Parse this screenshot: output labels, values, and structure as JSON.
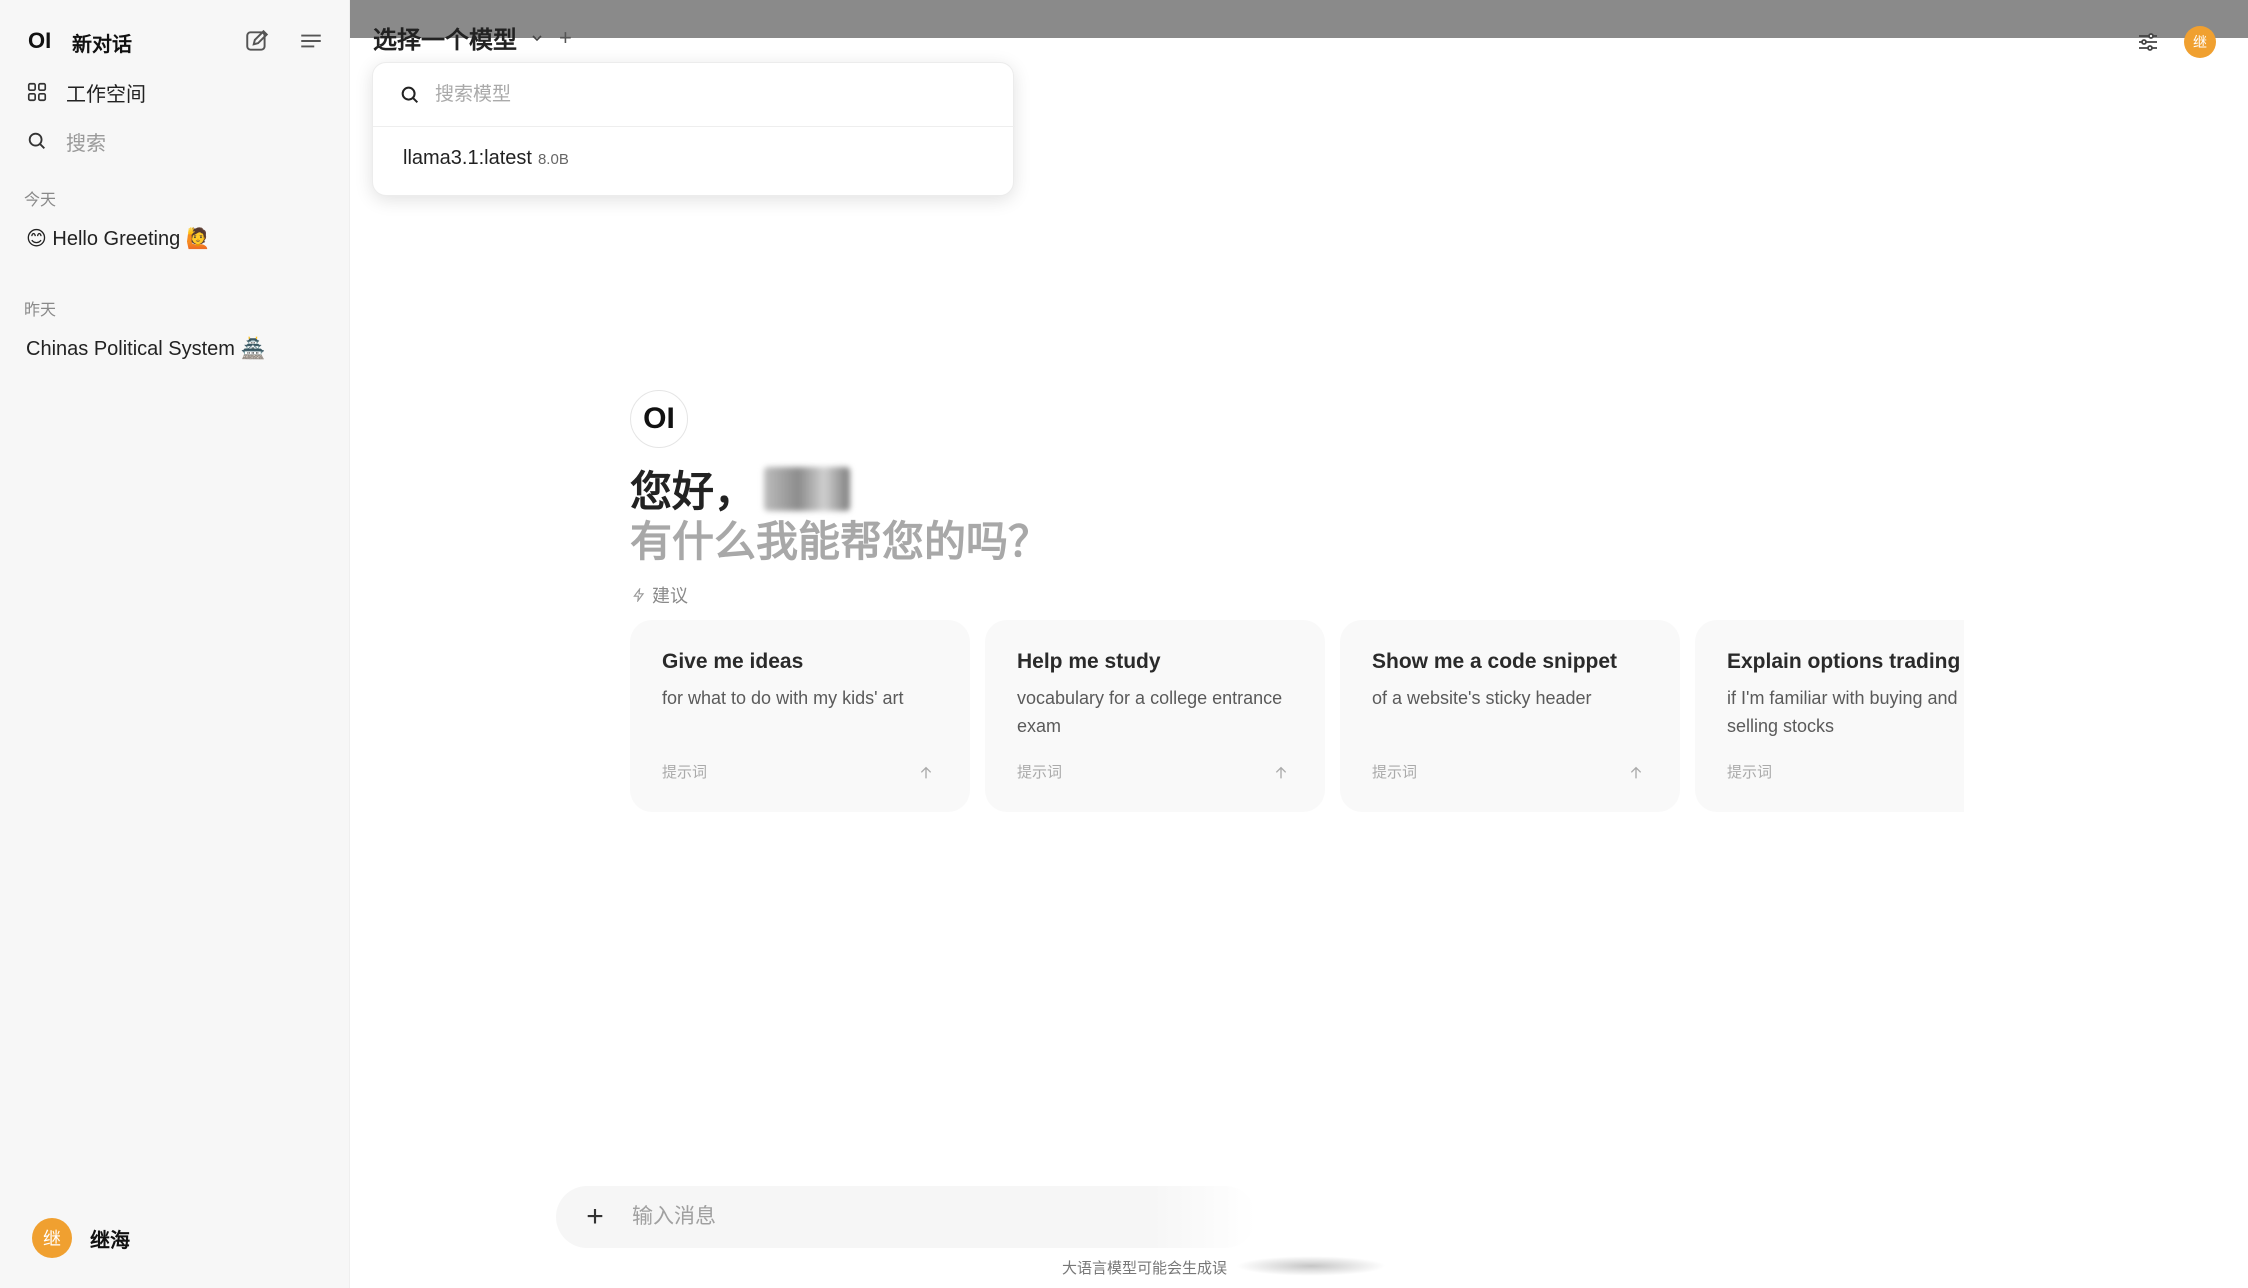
{
  "sidebar": {
    "logo": "OI",
    "new_chat": "新对话",
    "workspace": "工作空间",
    "search": "搜索",
    "sections": [
      {
        "label": "今天",
        "chats": [
          "😊 Hello Greeting 🙋"
        ]
      },
      {
        "label": "昨天",
        "chats": [
          "Chinas Political System 🏯"
        ]
      }
    ],
    "user": {
      "avatar": "继",
      "name": "继海"
    }
  },
  "header": {
    "model_selector": "选择一个模型",
    "add": "+",
    "avatar": "继"
  },
  "model_dropdown": {
    "search_placeholder": "搜索模型",
    "items": [
      {
        "name": "llama3.1:latest",
        "size": "8.0B"
      }
    ]
  },
  "main": {
    "logo": "OI",
    "greeting": "您好，",
    "subgreeting": "有什么我能帮您的吗？",
    "suggestions_label": "建议",
    "cards": [
      {
        "title": "Give me ideas",
        "desc": "for what to do with my kids' art",
        "foot": "提示词"
      },
      {
        "title": "Help me study",
        "desc": "vocabulary for a college entrance exam",
        "foot": "提示词"
      },
      {
        "title": "Show me a code snippet",
        "desc": "of a website's sticky header",
        "foot": "提示词"
      },
      {
        "title": "Explain options trading",
        "desc": "if I'm familiar with buying and selling stocks",
        "foot": "提示词"
      }
    ]
  },
  "composer": {
    "placeholder": "输入消息",
    "disclaimer": "大语言模型可能会生成误"
  }
}
